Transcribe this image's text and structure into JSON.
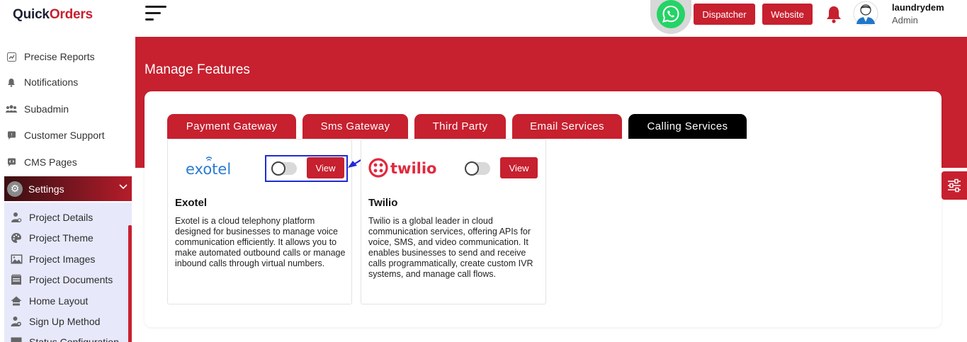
{
  "brand": {
    "logo_left": "Quick",
    "logo_right": "Orders"
  },
  "sidebar": {
    "items": [
      {
        "label": "Precise Reports",
        "icon": "reports-icon"
      },
      {
        "label": "Notifications",
        "icon": "bell-icon"
      },
      {
        "label": "Subadmin",
        "icon": "users-icon"
      },
      {
        "label": "Customer Support",
        "icon": "chat-icon"
      },
      {
        "label": "CMS Pages",
        "icon": "code-icon"
      }
    ],
    "settings": {
      "label": "Settings",
      "icon": "gear-icon"
    },
    "submenu": [
      {
        "label": "Project Details",
        "icon": "user-gear-icon"
      },
      {
        "label": "Project Theme",
        "icon": "palette-icon"
      },
      {
        "label": "Project Images",
        "icon": "image-icon"
      },
      {
        "label": "Project Documents",
        "icon": "document-icon"
      },
      {
        "label": "Home Layout",
        "icon": "home-icon"
      },
      {
        "label": "Sign Up Method",
        "icon": "user-plus-icon"
      },
      {
        "label": "Status Configuration",
        "icon": "list-icon"
      }
    ]
  },
  "header": {
    "dispatcher_label": "Dispatcher",
    "website_label": "Website",
    "user_name": "laundrydem",
    "user_role": "Admin"
  },
  "main": {
    "title": "Manage Features",
    "tabs": [
      {
        "label": "Payment Gateway",
        "active": false
      },
      {
        "label": "Sms Gateway",
        "active": false
      },
      {
        "label": "Third Party",
        "active": false
      },
      {
        "label": "Email Services",
        "active": false
      },
      {
        "label": "Calling Services",
        "active": true
      }
    ],
    "features": [
      {
        "logo_text": "exotel",
        "name": "Exotel",
        "description": "Exotel is a cloud telephony platform designed for businesses to manage voice communication efficiently. It allows you to make automated outbound calls or manage inbound calls through virtual numbers.",
        "enabled": false,
        "view_label": "View"
      },
      {
        "logo_text": "twilio",
        "name": "Twilio",
        "description": "Twilio is a global leader in cloud communication services, offering APIs for voice, SMS, and video communication. It enables businesses to send and receive calls programmatically, create custom IVR systems, and manage call flows.",
        "enabled": false,
        "view_label": "View"
      }
    ]
  },
  "colors": {
    "accent": "#c7202f",
    "active_tab": "#000000",
    "annotation": "#1f2bd4",
    "whatsapp": "#25d366"
  }
}
